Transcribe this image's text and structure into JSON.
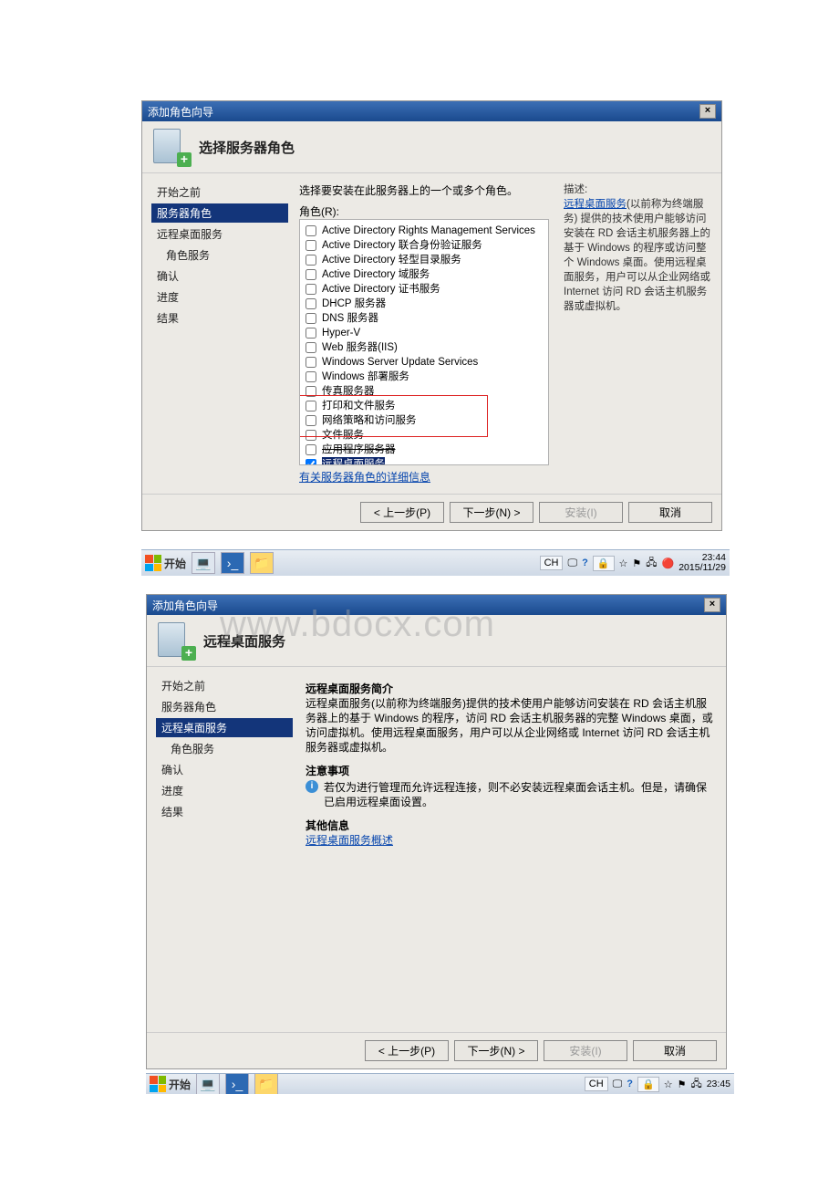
{
  "win1": {
    "title": "添加角色向导",
    "header": "选择服务器角色",
    "nav": [
      "开始之前",
      "服务器角色",
      "远程桌面服务",
      "角色服务",
      "确认",
      "进度",
      "结果"
    ],
    "nav_selected_index": 1,
    "content": {
      "prompt": "选择要安装在此服务器上的一个或多个角色。",
      "roles_label": "角色(R):",
      "roles": [
        {
          "label": "Active Directory Rights Management Services",
          "checked": false
        },
        {
          "label": "Active Directory 联合身份验证服务",
          "checked": false
        },
        {
          "label": "Active Directory 轻型目录服务",
          "checked": false
        },
        {
          "label": "Active Directory 域服务",
          "checked": false
        },
        {
          "label": "Active Directory 证书服务",
          "checked": false
        },
        {
          "label": "DHCP 服务器",
          "checked": false
        },
        {
          "label": "DNS 服务器",
          "checked": false
        },
        {
          "label": "Hyper-V",
          "checked": false
        },
        {
          "label": "Web 服务器(IIS)",
          "checked": false
        },
        {
          "label": "Windows Server Update Services",
          "checked": false
        },
        {
          "label": "Windows 部署服务",
          "checked": false
        },
        {
          "label": "传真服务器",
          "checked": false
        },
        {
          "label": "打印和文件服务",
          "checked": false
        },
        {
          "label": "网络策略和访问服务",
          "checked": false
        },
        {
          "label": "文件服务",
          "checked": false
        },
        {
          "label": "应用程序服务器",
          "checked": false,
          "strike": true
        },
        {
          "label": "远程桌面服务",
          "checked": true,
          "selected": true
        }
      ],
      "more_link": "有关服务器角色的详细信息"
    },
    "desc": {
      "title": "描述:",
      "link": "远程桌面服务",
      "text": "(以前称为终端服务) 提供的技术使用户能够访问安装在 RD 会话主机服务器上的基于 Windows 的程序或访问整个 Windows 桌面。使用远程桌面服务，用户可以从企业网络或 Internet 访问 RD 会话主机服务器或虚拟机。"
    },
    "buttons": {
      "prev": "< 上一步(P)",
      "next": "下一步(N) >",
      "install": "安装(I)",
      "cancel": "取消"
    }
  },
  "taskbar1": {
    "start": "开始",
    "ime": "CH",
    "time": "23:44",
    "date": "2015/11/29"
  },
  "win2": {
    "title": "添加角色向导",
    "header": "远程桌面服务",
    "nav": [
      "开始之前",
      "服务器角色",
      "远程桌面服务",
      "角色服务",
      "确认",
      "进度",
      "结果"
    ],
    "nav_selected_index": 2,
    "content": {
      "intro_title": "远程桌面服务简介",
      "intro_text": "远程桌面服务(以前称为终端服务)提供的技术使用户能够访问安装在 RD 会话主机服务器上的基于 Windows 的程序，访问 RD 会话主机服务器的完整 Windows 桌面，或访问虚拟机。使用远程桌面服务，用户可以从企业网络或 Internet 访问 RD 会话主机服务器或虚拟机。",
      "note_title": "注意事项",
      "note_text": "若仅为进行管理而允许远程连接，则不必安装远程桌面会话主机。但是，请确保已启用远程桌面设置。",
      "other_title": "其他信息",
      "other_link": "远程桌面服务概述"
    },
    "buttons": {
      "prev": "< 上一步(P)",
      "next": "下一步(N) >",
      "install": "安装(I)",
      "cancel": "取消"
    }
  },
  "taskbar2": {
    "start": "开始",
    "ime": "CH",
    "time": "23:45"
  },
  "watermark": "www.bdocx.com"
}
